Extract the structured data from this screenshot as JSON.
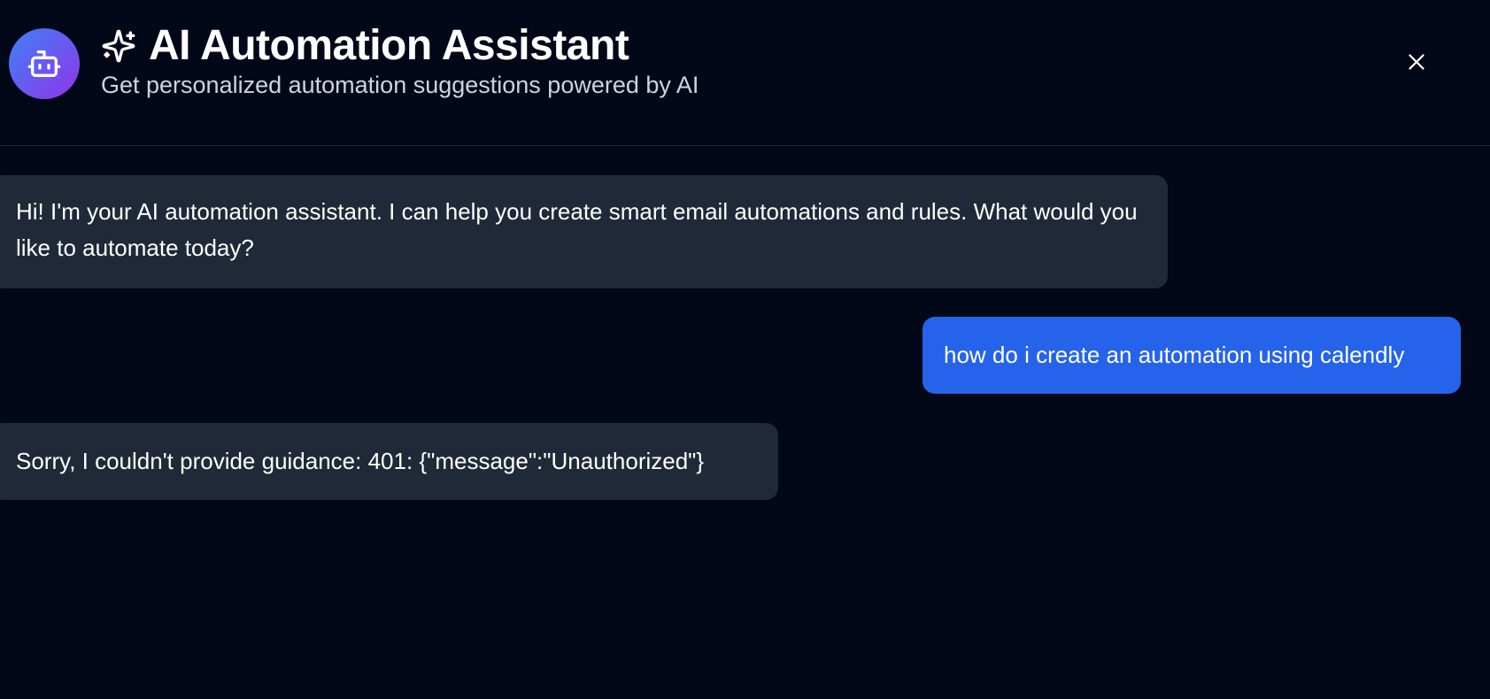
{
  "header": {
    "title": "AI Automation Assistant",
    "subtitle": "Get personalized automation suggestions powered by AI",
    "avatar_icon": "robot-icon",
    "title_icon": "sparkles-icon",
    "close_icon": "close-icon"
  },
  "messages": [
    {
      "role": "assistant",
      "text": "Hi! I'm your AI automation assistant. I can help you create smart email automations and rules. What would you like to automate today?"
    },
    {
      "role": "user",
      "text": "how do i create an automation using calendly"
    },
    {
      "role": "assistant",
      "text": "Sorry, I couldn't provide guidance: 401: {\"message\":\"Unauthorized\"}"
    }
  ],
  "colors": {
    "background": "#020817",
    "assistant_bubble": "#1f2937",
    "user_bubble": "#2563eb",
    "avatar_gradient_start": "#3b82f6",
    "avatar_gradient_end": "#9333ea"
  }
}
